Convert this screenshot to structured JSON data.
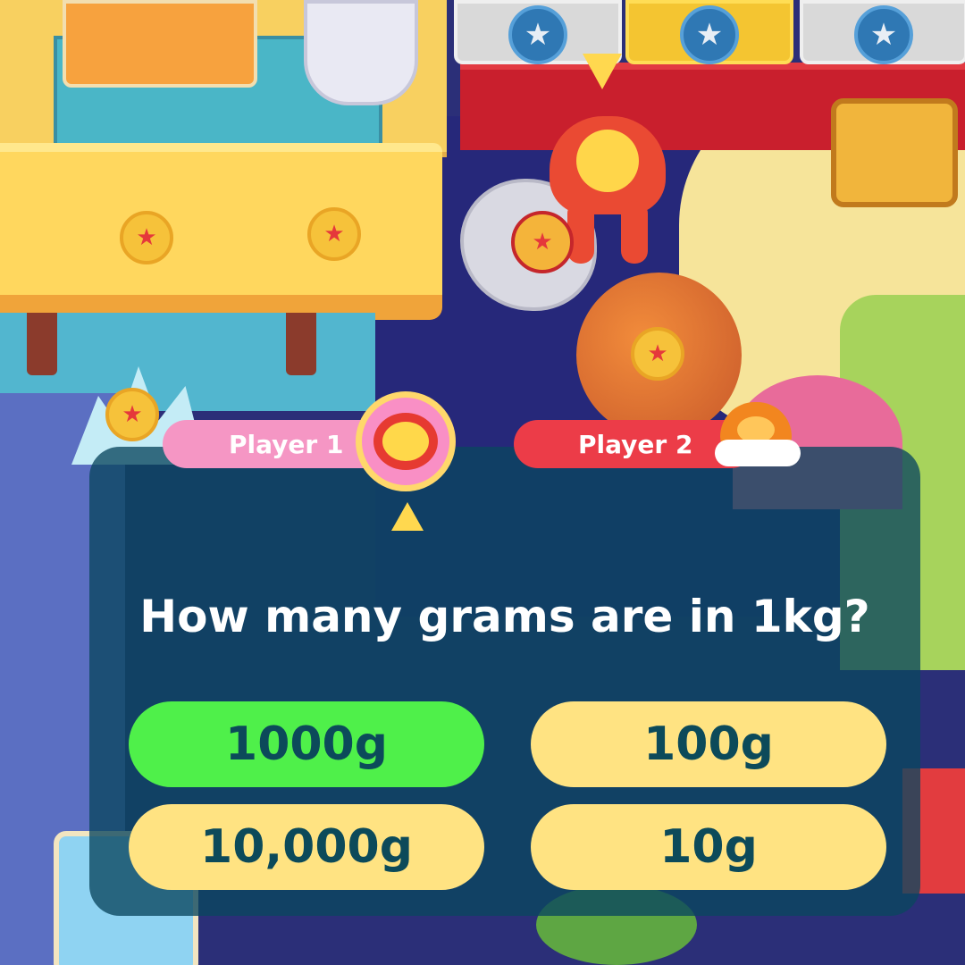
{
  "players": [
    {
      "label": "Player 1",
      "color": "#f596c4",
      "active": true
    },
    {
      "label": "Player 2",
      "color": "#ec3c48",
      "active": false
    }
  ],
  "quiz": {
    "question": "How many grams are in 1kg?",
    "answers": [
      {
        "label": "1000g",
        "state": "correct",
        "color": "#4ff04a"
      },
      {
        "label": "100g",
        "state": "default",
        "color": "#ffe382"
      },
      {
        "label": "10,000g",
        "state": "default",
        "color": "#ffe382"
      },
      {
        "label": "10g",
        "state": "default",
        "color": "#ffe382"
      }
    ]
  },
  "board": {
    "star_icon": "★",
    "panel_color": "#0a465f"
  }
}
